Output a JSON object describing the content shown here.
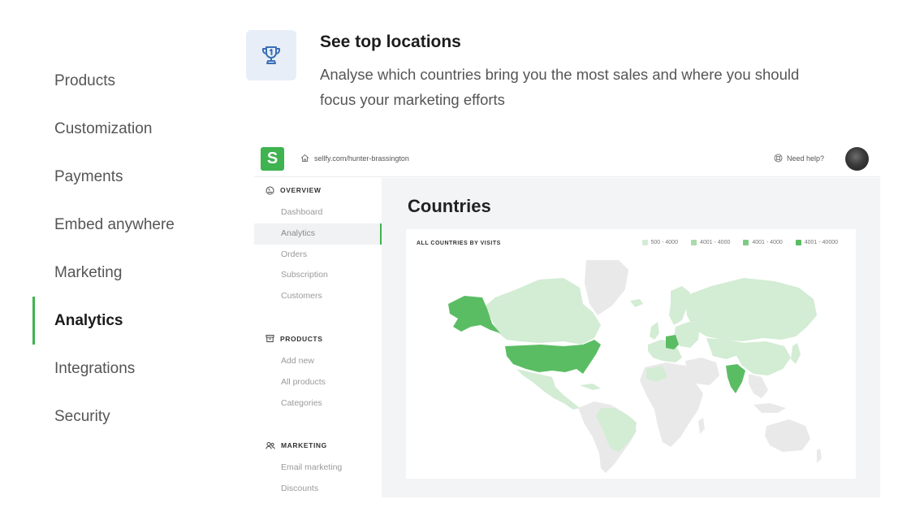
{
  "feature_nav": {
    "items": [
      {
        "label": "Products",
        "active": false
      },
      {
        "label": "Customization",
        "active": false
      },
      {
        "label": "Payments",
        "active": false
      },
      {
        "label": "Embed anywhere",
        "active": false
      },
      {
        "label": "Marketing",
        "active": false
      },
      {
        "label": "Analytics",
        "active": true
      },
      {
        "label": "Integrations",
        "active": false
      },
      {
        "label": "Security",
        "active": false
      }
    ]
  },
  "feature": {
    "icon": "trophy-icon",
    "title": "See top locations",
    "description": "Analyse which countries bring you the most sales and where you should focus your marketing efforts"
  },
  "app": {
    "logo": "S",
    "store_url": "sellfy.com/hunter-brassington",
    "help_label": "Need help?",
    "sidebar": {
      "sections": [
        {
          "title": "OVERVIEW",
          "icon": "dashboard-gauge-icon",
          "items": [
            "Dashboard",
            "Analytics",
            "Orders",
            "Subscription",
            "Customers"
          ],
          "active_index": 1
        },
        {
          "title": "PRODUCTS",
          "icon": "box-icon",
          "items": [
            "Add new",
            "All products",
            "Categories"
          ],
          "active_index": -1
        },
        {
          "title": "MARKETING",
          "icon": "people-icon",
          "items": [
            "Email marketing",
            "Discounts"
          ],
          "active_index": -1
        }
      ]
    },
    "main": {
      "title": "Countries",
      "card_title": "ALL COUNTRIES BY VISITS",
      "legend": [
        {
          "label": "500 - 4000",
          "color": "#d3ecd4"
        },
        {
          "label": "4001 - 4000",
          "color": "#a9dbac"
        },
        {
          "label": "4001 - 4000",
          "color": "#7fcb85"
        },
        {
          "label": "4001 - 40000",
          "color": "#5bbd63"
        }
      ]
    }
  },
  "colors": {
    "accent": "#3fb34f",
    "map_base": "#e9e9e9",
    "map_light": "#d3ecd4",
    "map_dark": "#5bbd63"
  }
}
